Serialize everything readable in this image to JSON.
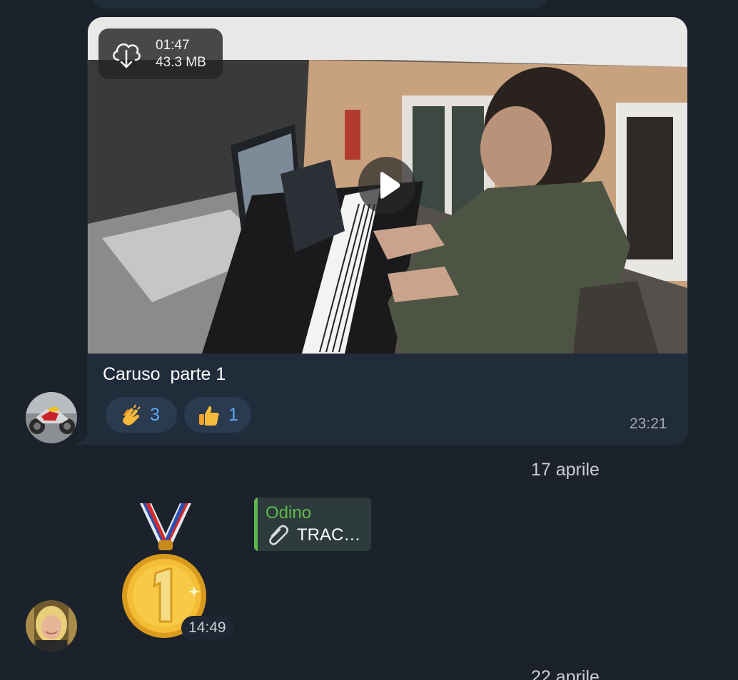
{
  "video_message": {
    "duration": "01:47",
    "file_size": "43.3 MB",
    "caption": "Caruso  parte 1",
    "reactions": [
      {
        "emoji": "clapping-hands",
        "count": "3"
      },
      {
        "emoji": "thumbs-up",
        "count": "1"
      }
    ],
    "time": "23:21"
  },
  "date_separators": [
    "17 aprile",
    "22 aprile"
  ],
  "reply_preview": {
    "author": "Odino",
    "text": "TRAC…"
  },
  "sticker_message": {
    "sticker": "gold-medal-1",
    "time": "14:49"
  },
  "colors": {
    "background": "#1b222c",
    "bubble": "#212c3b",
    "reaction_pill": "#2a3a4f",
    "reaction_count": "#5ea9f2",
    "reply_accent": "#5cb84a"
  }
}
